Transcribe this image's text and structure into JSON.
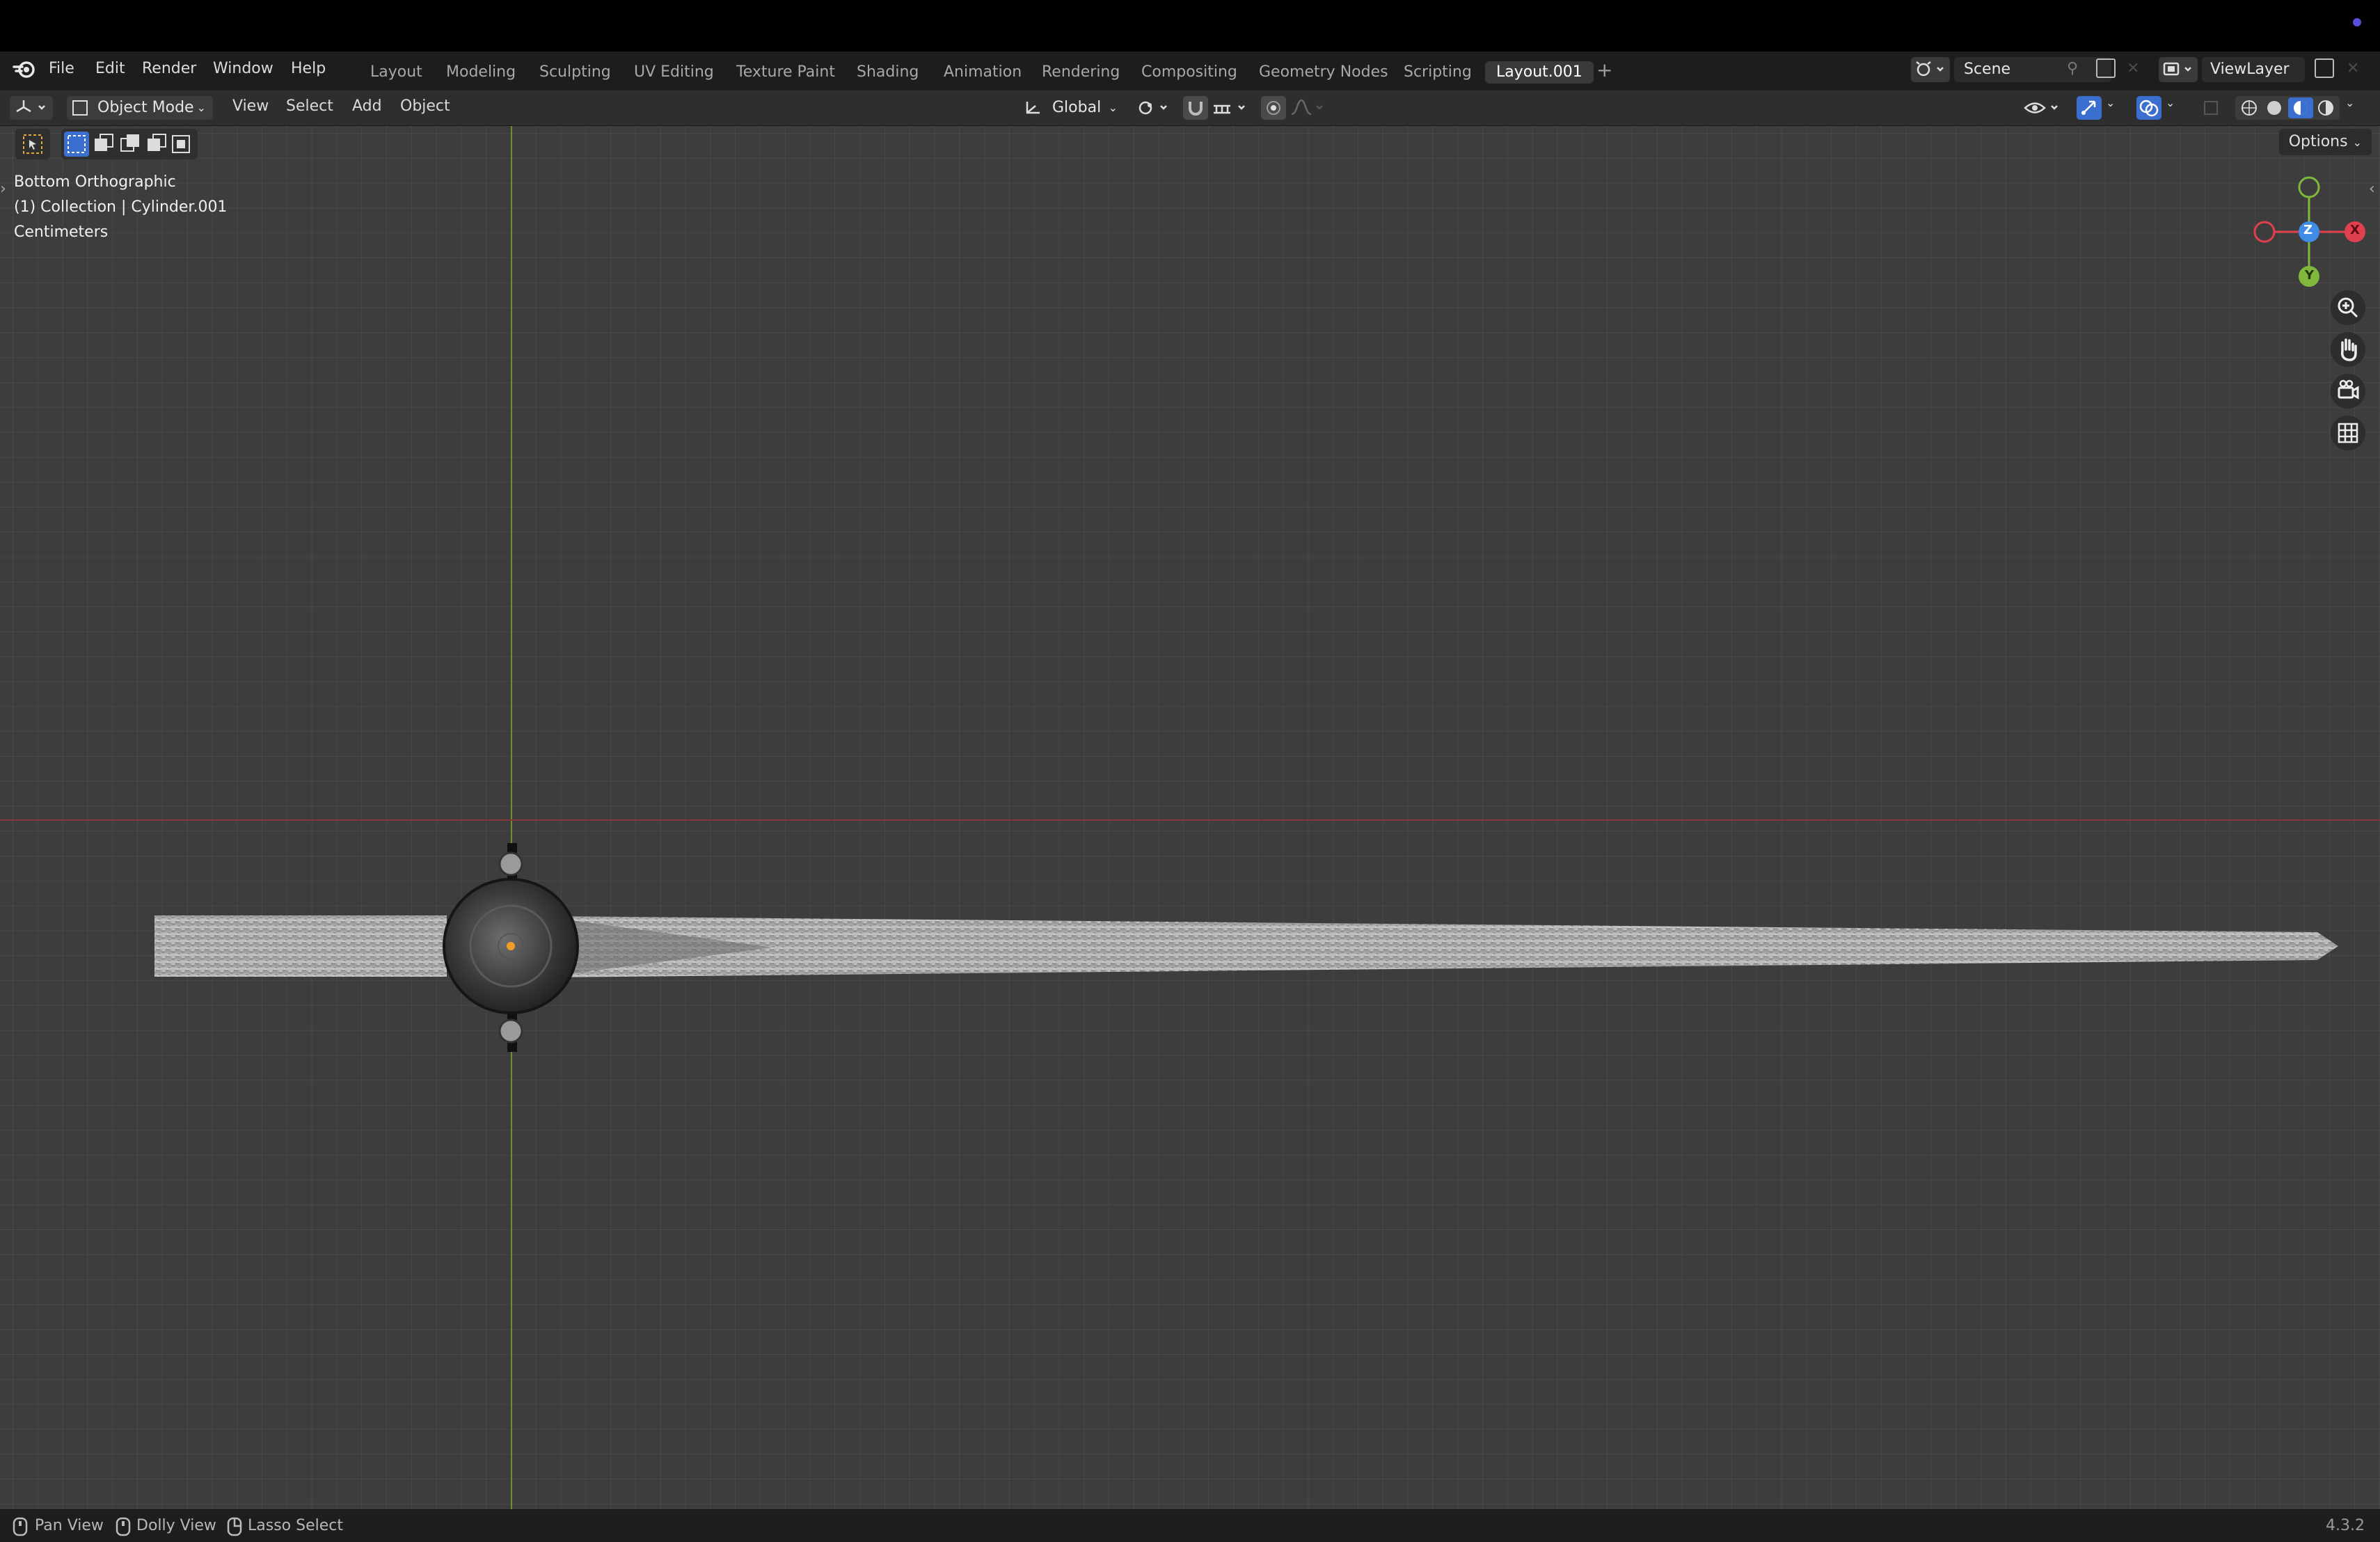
{
  "app": {
    "name": "Blender",
    "version": "4.3.2",
    "accent": "#5a4fd8"
  },
  "menu": {
    "items": [
      "File",
      "Edit",
      "Render",
      "Window",
      "Help"
    ]
  },
  "workspaces": {
    "tabs": [
      "Layout",
      "Modeling",
      "Sculpting",
      "UV Editing",
      "Texture Paint",
      "Shading",
      "Animation",
      "Rendering",
      "Compositing",
      "Geometry Nodes",
      "Scripting",
      "Layout.001"
    ],
    "active": "Layout.001",
    "add_icon": "plus-icon"
  },
  "scene": {
    "label": "Scene"
  },
  "view_layer": {
    "label": "ViewLayer"
  },
  "header": {
    "mode": "Object Mode",
    "menus": [
      "View",
      "Select",
      "Add",
      "Object"
    ],
    "transform_orientation": "Global"
  },
  "viewport": {
    "view_name": "Bottom Orthographic",
    "collection_info": "(1) Collection | Cylinder.001",
    "units": "Centimeters",
    "options_label": "Options",
    "gizmo": {
      "z_label": "Z",
      "x_label": "X",
      "y_label": "Y",
      "x_color": "#e0404d",
      "y_color": "#7fb83c",
      "z_color": "#3f8be6"
    }
  },
  "statusbar": {
    "items": [
      "Pan View",
      "Dolly View",
      "Lasso Select"
    ],
    "version": "4.3.2"
  }
}
